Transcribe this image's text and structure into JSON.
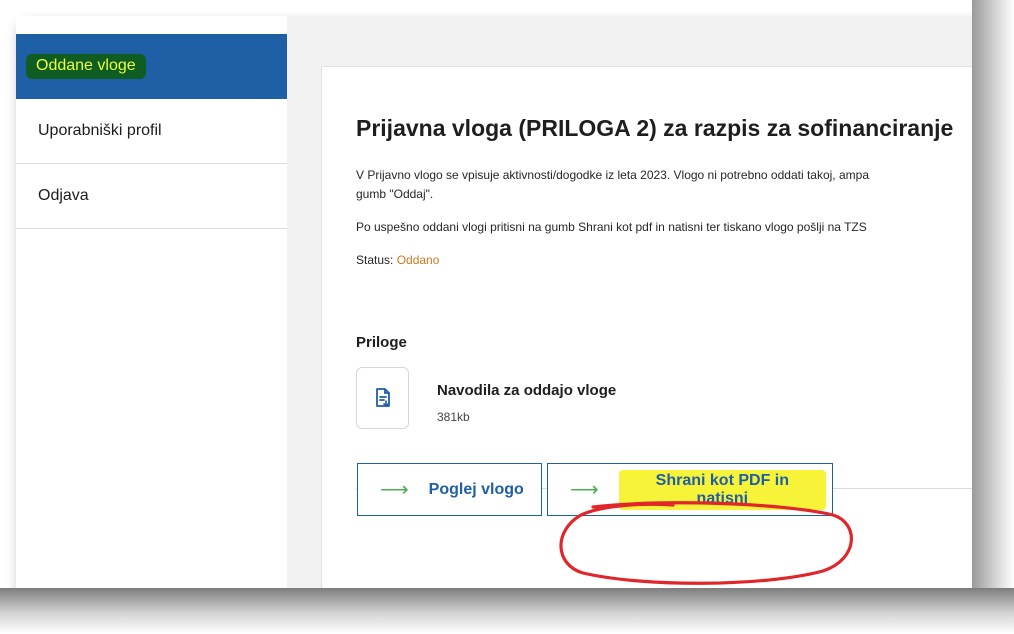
{
  "sidebar": {
    "items": [
      {
        "label": "Oddane vloge"
      },
      {
        "label": "Uporabniški profil"
      },
      {
        "label": "Odjava"
      }
    ]
  },
  "main": {
    "title": "Prijavna vloga (PRILOGA 2) za razpis za sofinanciranje",
    "paragraph1_line1": "V Prijavno vlogo se vpisuje aktivnosti/dogodke iz leta 2023. Vlogo ni potrebno oddati takoj, ampa",
    "paragraph1_line2": "gumb \"Oddaj\".",
    "paragraph2": "Po uspešno oddani vlogi pritisni na gumb Shrani kot pdf in natisni ter tiskano vlogo pošlji na TZS",
    "status_label": "Status:",
    "status_value": "Oddano",
    "attachments": {
      "title": "Priloge",
      "items": [
        {
          "name": "Navodila za oddajo vloge",
          "size": "381kb",
          "icon": "document-download-icon"
        }
      ]
    },
    "buttons": {
      "view_label": "Poglej vlogo",
      "save_pdf_label": "Shrani kot PDF in natisni",
      "arrow_glyph": "⟶"
    }
  },
  "colors": {
    "primary": "#1f5fa6",
    "status": "#d07a1e",
    "arrow": "#4caf50",
    "highlight_yellow": "#f7f339",
    "highlight_green": "#0f5d23",
    "annotation_red": "#e0262b"
  }
}
